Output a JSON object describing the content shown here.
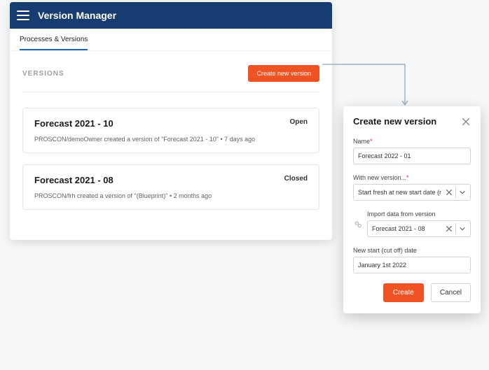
{
  "app": {
    "title": "Version Manager"
  },
  "tabs": {
    "main": "Processes & Versions"
  },
  "section": {
    "heading": "VERSIONS",
    "create_btn": "Create new version"
  },
  "versions": [
    {
      "title": "Forecast 2021 - 10",
      "status": "Open",
      "sub": "PROSCON/demoOwner created a version of \"Forecast 2021 - 10\"  •  7 days ago"
    },
    {
      "title": "Forecast 2021 - 08",
      "status": "Closed",
      "sub": "PROSCON/frh created a version of \"(Blueprint)\"  •  2 months ago"
    }
  ],
  "dialog": {
    "title": "Create new version",
    "name_label": "Name",
    "name_value": "Forecast 2022 - 01",
    "mode_label": "With new version...",
    "mode_value": "Start fresh at new start date (r",
    "import_label": "Import data from version",
    "import_value": "Forecast 2021 - 08",
    "date_label": "New start (cut off) date",
    "date_value": "January 1st 2022",
    "create": "Create",
    "cancel": "Cancel"
  }
}
